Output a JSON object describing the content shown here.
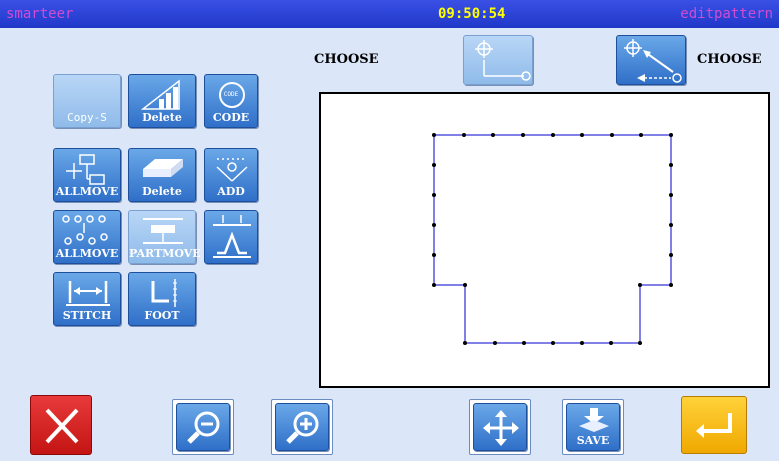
{
  "header": {
    "app_name": "smarteer",
    "time": "09:50:54",
    "mode": "editpattern"
  },
  "top": {
    "choose_left": "CHOOSE",
    "choose_right": "CHOOSE"
  },
  "tools": {
    "copy_s": "Copy-S",
    "delete_1": "Delete",
    "code_icon_text": "CODE",
    "code": "CODE",
    "allmove_1": "ALLMOVE",
    "delete_2": "Delete",
    "add": "ADD",
    "allmove_2": "ALLMOVE",
    "partmove": "PARTMOVE",
    "stitch": "STITCH",
    "foot": "FOOT"
  },
  "bottom": {
    "save": "SAVE"
  },
  "colors": {
    "header_bg": "#2a42d6",
    "accent_blue": "#2f6fc8",
    "cancel_red": "#d61f1f",
    "enter_yellow": "#f3b400"
  },
  "pattern": {
    "stitch_color": "#0000cc",
    "point_color": "#000000"
  }
}
